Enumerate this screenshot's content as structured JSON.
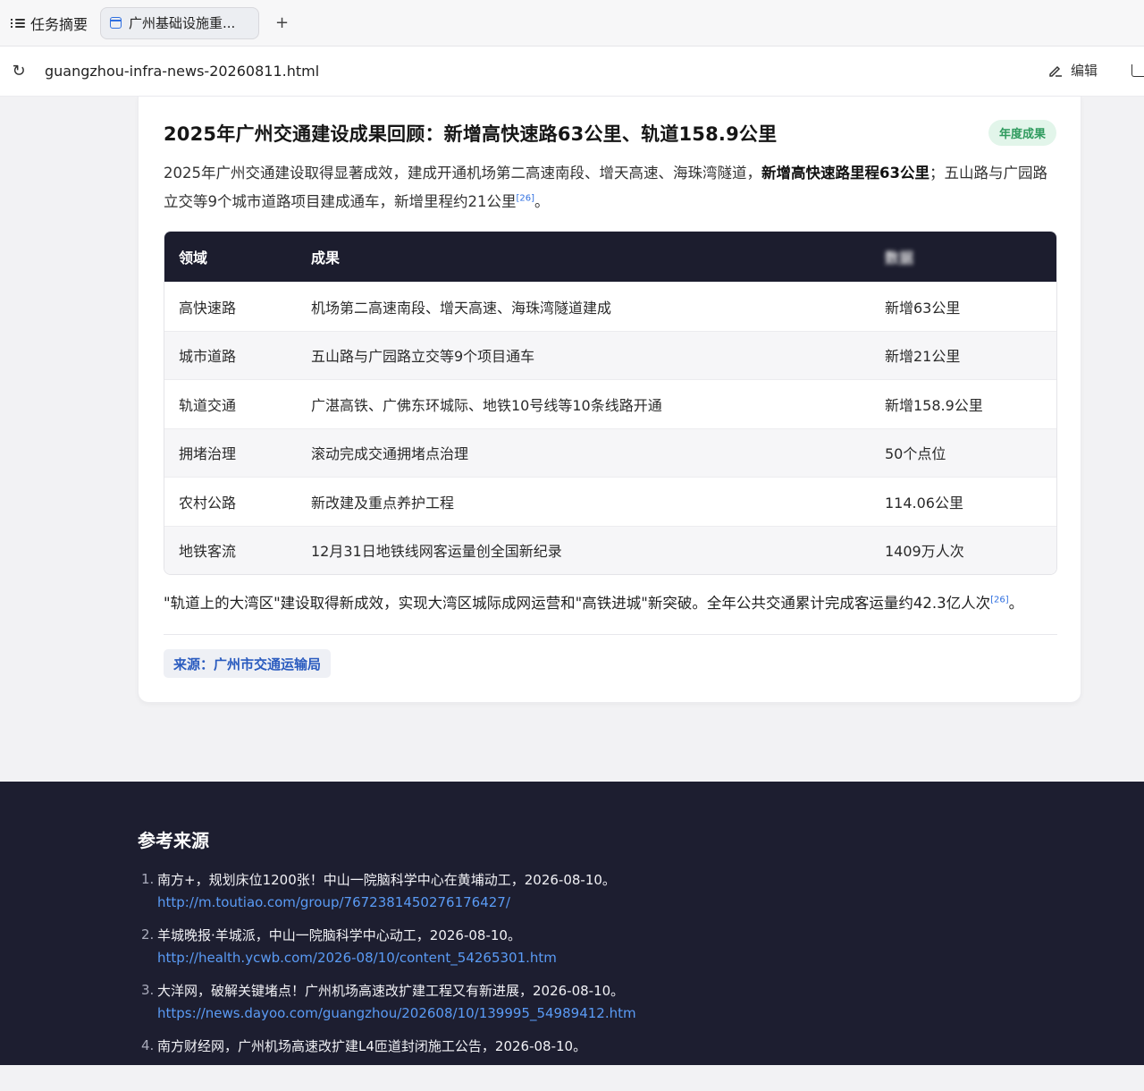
{
  "tabbar": {
    "summary_label": "任务摘要",
    "tab_title": "广州基础设施重...",
    "new_tab": "+"
  },
  "addressbar": {
    "url": "guangzhou-infra-news-20260811.html",
    "edit_label": "编辑"
  },
  "card": {
    "title": "2025年广州交通建设成果回顾：新增高快速路63公里、轨道158.9公里",
    "badge": "年度成果",
    "lead_part1": "2025年广州交通建设取得显著成效，建成开通机场第二高速南段、增天高速、海珠湾隧道，",
    "lead_bold": "新增高快速路里程63公里",
    "lead_part2": "；五山路与广园路立交等9个城市道路项目建成通车，新增里程约21公里",
    "lead_cite": "[26]",
    "lead_end": "。",
    "table": {
      "headers": [
        "领域",
        "成果",
        "数据"
      ],
      "rows": [
        [
          "高快速路",
          "机场第二高速南段、增天高速、海珠湾隧道建成",
          "新增63公里"
        ],
        [
          "城市道路",
          "五山路与广园路立交等9个项目通车",
          "新增21公里"
        ],
        [
          "轨道交通",
          "广湛高铁、广佛东环城际、地铁10号线等10条线路开通",
          "新增158.9公里"
        ],
        [
          "拥堵治理",
          "滚动完成交通拥堵点治理",
          "50个点位"
        ],
        [
          "农村公路",
          "新改建及重点养护工程",
          "114.06公里"
        ],
        [
          "地铁客流",
          "12月31日地铁线网客运量创全国新纪录",
          "1409万人次"
        ]
      ]
    },
    "after_text": "\"轨道上的大湾区\"建设取得新成效，实现大湾区城际成网运营和\"高铁进城\"新突破。全年公共交通累计完成客运量约42.3亿人次",
    "after_cite": "[26]",
    "after_end": "。",
    "source": "来源：广州市交通运输局"
  },
  "references": {
    "title": "参考来源",
    "items": [
      {
        "num": "1.",
        "text": "南方+，规划床位1200张！中山一院脑科学中心在黄埔动工，2026-08-10。",
        "link": "http://m.toutiao.com/group/7672381450276176427/"
      },
      {
        "num": "2.",
        "text": "羊城晚报·羊城派，中山一院脑科学中心动工，2026-08-10。",
        "link": "http://health.ycwb.com/2026-08/10/content_54265301.htm"
      },
      {
        "num": "3.",
        "text": "大洋网，破解关键堵点！广州机场高速改扩建工程又有新进展，2026-08-10。",
        "link": "https://news.dayoo.com/guangzhou/202608/10/139995_54989412.htm"
      },
      {
        "num": "4.",
        "text": "南方财经网，广州机场高速改扩建L4匝道封闭施工公告，2026-08-10。",
        "link": ""
      }
    ]
  }
}
